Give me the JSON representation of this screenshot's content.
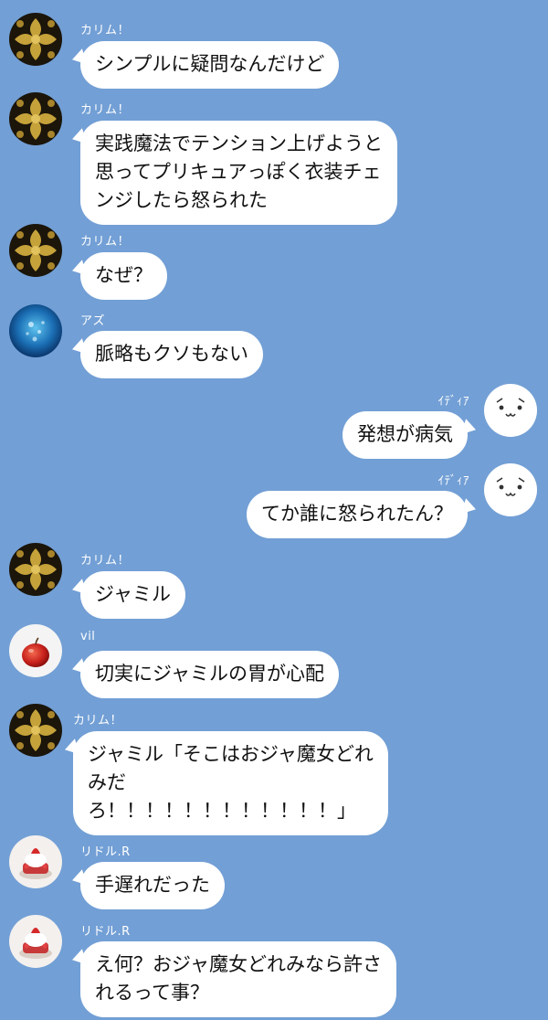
{
  "colors": {
    "background": "#729fd5",
    "bubble": "#ffffff",
    "text": "#111111",
    "sender_text": "#ffffff"
  },
  "messages": [
    {
      "sender": "カリム！",
      "avatar": "damask-pattern-avatar",
      "side": "left",
      "lines": [
        "シンプルに疑問なんだけど"
      ]
    },
    {
      "sender": "カリム！",
      "avatar": "damask-pattern-avatar",
      "side": "left",
      "lines": [
        "実践魔法でテンション上げようと",
        "思ってプリキュアっぽく衣装チェ",
        "ンジしたら怒られた"
      ]
    },
    {
      "sender": "カリム！",
      "avatar": "damask-pattern-avatar",
      "side": "left",
      "lines": [
        "なぜ？"
      ]
    },
    {
      "sender": "アズ",
      "avatar": "ocean-bubbles-avatar",
      "side": "left",
      "lines": [
        "脈略もクソもない"
      ]
    },
    {
      "sender": "ｲﾃﾞｨｱ",
      "avatar": "cute-face-avatar",
      "side": "right",
      "lines": [
        "発想が病気"
      ]
    },
    {
      "sender": "ｲﾃﾞｨｱ",
      "avatar": "cute-face-avatar",
      "side": "right",
      "lines": [
        "てか誰に怒られたん？"
      ]
    },
    {
      "sender": "カリム！",
      "avatar": "damask-pattern-avatar",
      "side": "left",
      "lines": [
        "ジャミル"
      ]
    },
    {
      "sender": "vil",
      "avatar": "apple-avatar",
      "side": "left",
      "lines": [
        "切実にジャミルの胃が心配"
      ]
    },
    {
      "sender": "カリム！",
      "avatar": "damask-pattern-avatar",
      "side": "left",
      "lines": [
        "ジャミル「そこはおジャ魔女どれ",
        "みだ",
        "ろ！！！！！！！！！！！！」"
      ]
    },
    {
      "sender": "リドル.R",
      "avatar": "strawberry-cake-avatar",
      "side": "left",
      "lines": [
        "手遅れだった"
      ]
    },
    {
      "sender": "リドル.R",
      "avatar": "strawberry-cake-avatar",
      "side": "left",
      "lines": [
        "え何？おジャ魔女どれみなら許さ",
        "れるって事？"
      ]
    }
  ]
}
